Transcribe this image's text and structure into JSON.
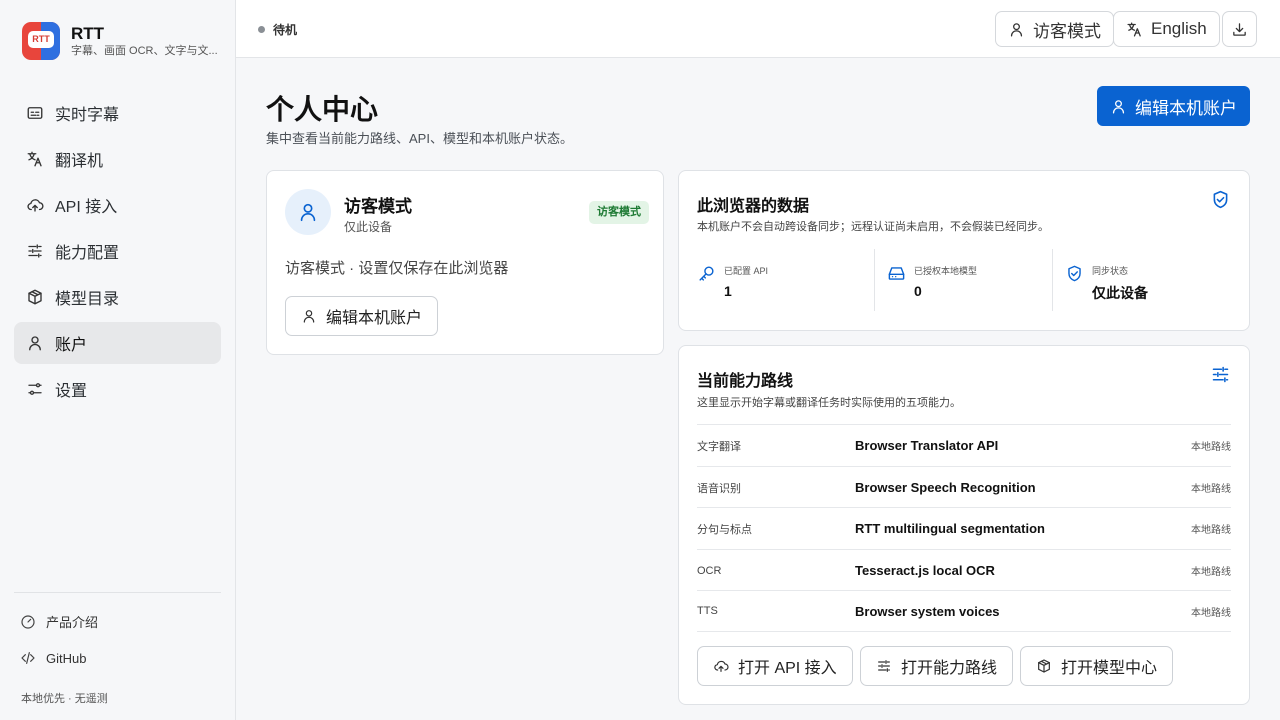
{
  "app": {
    "name": "RTT",
    "subtitle": "字幕、画面 OCR、文字与文...",
    "logo_text": "RTT",
    "brand_colors": {
      "red": "#e8453c",
      "blue": "#2f6fe0"
    }
  },
  "sidebar": {
    "items": [
      {
        "label": "实时字幕",
        "icon": "subtitles-icon",
        "active": false
      },
      {
        "label": "翻译机",
        "icon": "translate-icon",
        "active": false
      },
      {
        "label": "API 接入",
        "icon": "cloud-upload-icon",
        "active": false
      },
      {
        "label": "能力配置",
        "icon": "sliders-icon",
        "active": false
      },
      {
        "label": "模型目录",
        "icon": "box-icon",
        "active": false
      },
      {
        "label": "账户",
        "icon": "user-icon",
        "active": true
      },
      {
        "label": "设置",
        "icon": "settings-icon",
        "active": false
      }
    ],
    "footer_links": [
      {
        "label": "产品介绍",
        "icon": "gauge-icon"
      },
      {
        "label": "GitHub",
        "icon": "code-icon"
      }
    ],
    "footer_note": "本地优先 · 无遥测"
  },
  "topbar": {
    "status": "待机",
    "guest_button": "访客模式",
    "language_button": "English",
    "download_icon": "download-icon"
  },
  "page": {
    "title": "个人中心",
    "subtitle": "集中查看当前能力路线、API、模型和本机账户状态。",
    "edit_button": "编辑本机账户",
    "accent_color": "#0a63d1"
  },
  "guest_card": {
    "name": "访客模式",
    "device": "仅此设备",
    "badge": "访客模式",
    "description": "访客模式 · 设置仅保存在此浏览器",
    "edit_button": "编辑本机账户"
  },
  "browser_data": {
    "title": "此浏览器的数据",
    "subtitle": "本机账户不会自动跨设备同步；远程认证尚未启用，不会假装已经同步。",
    "stats": [
      {
        "label": "已配置 API",
        "value": "1",
        "icon": "key-icon"
      },
      {
        "label": "已授权本地模型",
        "value": "0",
        "icon": "drive-icon"
      },
      {
        "label": "同步状态",
        "value": "仅此设备",
        "icon": "shield-check-icon"
      }
    ]
  },
  "routes": {
    "title": "当前能力路线",
    "subtitle": "这里显示开始字幕或翻译任务时实际使用的五项能力。",
    "rows": [
      {
        "capability": "文字翻译",
        "route": "Browser Translator API",
        "tag": "本地路线"
      },
      {
        "capability": "语音识别",
        "route": "Browser Speech Recognition",
        "tag": "本地路线"
      },
      {
        "capability": "分句与标点",
        "route": "RTT multilingual segmentation",
        "tag": "本地路线"
      },
      {
        "capability": "OCR",
        "route": "Tesseract.js local OCR",
        "tag": "本地路线"
      },
      {
        "capability": "TTS",
        "route": "Browser system voices",
        "tag": "本地路线"
      }
    ],
    "buttons": {
      "open_api": "打开 API 接入",
      "open_routes": "打开能力路线",
      "open_models": "打开模型中心"
    }
  }
}
